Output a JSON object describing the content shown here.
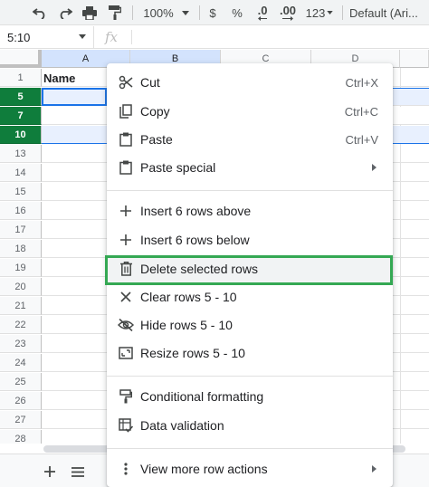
{
  "toolbar": {
    "zoom": "100%",
    "currency": "$",
    "percent": "%",
    "decrease_decimal": ".0",
    "increase_decimal": ".00",
    "number_format": "123",
    "font": "Default (Ari..."
  },
  "formula_bar": {
    "cell_ref": "5:10",
    "fx": "fx"
  },
  "columns": [
    "A",
    "B",
    "C",
    "D"
  ],
  "rows": [
    "1",
    "5",
    "7",
    "10",
    "13",
    "14",
    "15",
    "16",
    "17",
    "18",
    "19",
    "20",
    "21",
    "22",
    "23",
    "24",
    "25",
    "26",
    "27",
    "28"
  ],
  "selected_rows": [
    "5",
    "7",
    "10"
  ],
  "cells": {
    "A1": "Name"
  },
  "context_menu": {
    "cut": {
      "label": "Cut",
      "shortcut": "Ctrl+X"
    },
    "copy": {
      "label": "Copy",
      "shortcut": "Ctrl+C"
    },
    "paste": {
      "label": "Paste",
      "shortcut": "Ctrl+V"
    },
    "paste_special": {
      "label": "Paste special"
    },
    "insert_above": {
      "label": "Insert 6 rows above"
    },
    "insert_below": {
      "label": "Insert 6 rows below"
    },
    "delete_rows": {
      "label": "Delete selected rows"
    },
    "clear_rows": {
      "label": "Clear rows 5 - 10"
    },
    "hide_rows": {
      "label": "Hide rows 5 - 10"
    },
    "resize_rows": {
      "label": "Resize rows 5 - 10"
    },
    "conditional_formatting": {
      "label": "Conditional formatting"
    },
    "data_validation": {
      "label": "Data validation"
    },
    "more_actions": {
      "label": "View more row actions"
    }
  },
  "colors": {
    "selected_row_header": "#0f7d3c",
    "selection_fill": "#e8f0fe",
    "highlight_outline": "#34a853"
  }
}
